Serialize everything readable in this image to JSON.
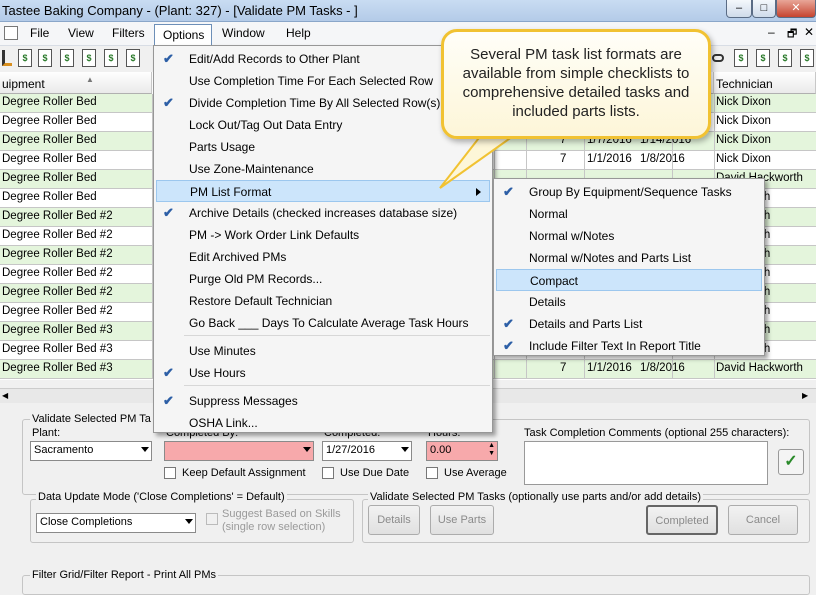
{
  "window": {
    "title": "Tastee Baking Company - (Plant: 327) - [Validate PM Tasks - ]",
    "buttons": [
      "–",
      "□",
      "✕"
    ]
  },
  "menubar": {
    "file": "File",
    "view": "View",
    "filters": "Filters",
    "options": "Options",
    "window": "Window",
    "help": "Help"
  },
  "mdi_buttons": [
    "–",
    "🗗",
    "✕"
  ],
  "grid": {
    "headers": {
      "equipment": "uipment",
      "technician": "Technician"
    },
    "rows": [
      {
        "equipment": "Degree Roller Bed",
        "n": "",
        "start": "",
        "end": "",
        "tech": "Nick Dixon",
        "green": true
      },
      {
        "equipment": "Degree Roller Bed",
        "n": "",
        "start": "",
        "end": "",
        "tech": "Nick Dixon",
        "green": false
      },
      {
        "equipment": "Degree Roller Bed",
        "n": "7",
        "start": "1/7/2016",
        "end": "1/14/2016",
        "tech": "Nick Dixon",
        "green": true
      },
      {
        "equipment": "Degree Roller Bed",
        "n": "7",
        "start": "1/1/2016",
        "end": "1/8/2016",
        "tech": "Nick Dixon",
        "green": false
      },
      {
        "equipment": "Degree Roller Bed",
        "n": "",
        "start": "",
        "end": "",
        "tech": "David Hackworth",
        "green": true
      },
      {
        "equipment": "Degree Roller Bed",
        "n": "",
        "start": "",
        "end": "",
        "tech": "Hackworth",
        "green": false
      },
      {
        "equipment": "Degree Roller Bed #2",
        "n": "",
        "start": "",
        "end": "",
        "tech": "Hackworth",
        "green": true
      },
      {
        "equipment": "Degree Roller Bed #2",
        "n": "",
        "start": "",
        "end": "",
        "tech": "Hackworth",
        "green": false
      },
      {
        "equipment": "Degree Roller Bed #2",
        "n": "",
        "start": "",
        "end": "",
        "tech": "Hackworth",
        "green": true
      },
      {
        "equipment": "Degree Roller Bed #2",
        "n": "",
        "start": "",
        "end": "",
        "tech": "Hackworth",
        "green": false
      },
      {
        "equipment": "Degree Roller Bed #2",
        "n": "",
        "start": "",
        "end": "",
        "tech": "Hackworth",
        "green": true
      },
      {
        "equipment": "Degree Roller Bed #2",
        "n": "",
        "start": "",
        "end": "",
        "tech": "Hackworth",
        "green": false
      },
      {
        "equipment": "Degree Roller Bed #3",
        "n": "",
        "start": "",
        "end": "",
        "tech": "Hackworth",
        "green": true
      },
      {
        "equipment": "Degree Roller Bed #3",
        "n": "",
        "start": "",
        "end": "",
        "tech": "Hackworth",
        "green": false
      },
      {
        "equipment": "Degree Roller Bed #3",
        "n": "7",
        "start": "1/1/2016",
        "end": "1/8/2016",
        "tech": "David Hackworth",
        "green": true
      }
    ]
  },
  "options_menu": {
    "items": [
      {
        "label": "Edit/Add Records to Other Plant",
        "checked": true
      },
      {
        "label": "Use Completion Time For Each Selected Row",
        "checked": false
      },
      {
        "label": "Divide Completion Time By All Selected Row(s)",
        "checked": true
      },
      {
        "label": "Lock Out/Tag Out Data Entry",
        "checked": false
      },
      {
        "label": "Parts Usage",
        "checked": false,
        "submenu": true
      },
      {
        "label": "Use Zone-Maintenance",
        "checked": false
      },
      {
        "label": "PM List Format",
        "checked": false,
        "submenu": true,
        "highlight": true
      },
      {
        "label": "Archive Details (checked increases database size)",
        "checked": true
      },
      {
        "label": "PM -> Work Order Link Defaults",
        "checked": false
      },
      {
        "label": "Edit Archived PMs",
        "checked": false
      },
      {
        "label": "Purge Old PM Records...",
        "checked": false
      },
      {
        "label": "Restore Default Technician",
        "checked": false
      },
      {
        "label": "Go Back ___ Days To Calculate Average Task Hours",
        "checked": false
      },
      {
        "label": "Use Minutes",
        "checked": false
      },
      {
        "label": "Use Hours",
        "checked": true
      },
      {
        "label": "Suppress Messages",
        "checked": true
      },
      {
        "label": "OSHA Link...",
        "checked": false
      }
    ]
  },
  "pm_format_submenu": {
    "items": [
      {
        "label": "Group By Equipment/Sequence Tasks",
        "checked": true
      },
      {
        "label": "Normal",
        "checked": false
      },
      {
        "label": "Normal w/Notes",
        "checked": false
      },
      {
        "label": "Normal w/Notes and Parts List",
        "checked": false
      },
      {
        "label": "Compact",
        "checked": false,
        "highlight": true
      },
      {
        "label": "Details",
        "checked": false
      },
      {
        "label": "Details and Parts List",
        "checked": true
      },
      {
        "label": "Include Filter Text In Report Title",
        "checked": true
      }
    ]
  },
  "callout": "Several PM task list formats are available from simple checklists to comprehensive detailed tasks and included parts lists.",
  "bottom": {
    "validate_group": "Validate Selected PM Ta",
    "plant_label": "Plant:",
    "plant_value": "Sacramento",
    "completed_by_label": "Completed By:",
    "completed_label": "Completed:",
    "completed_value": "1/27/2016",
    "hours_label": "Hours:",
    "hours_value": "0.00",
    "comments_label": "Task Completion Comments (optional 255 characters):",
    "keep_default": "Keep Default Assignment",
    "use_due_date": "Use Due Date",
    "use_average": "Use Average",
    "data_update_group": "Data Update Mode ('Close Completions' = Default)",
    "data_update_value": "Close Completions",
    "suggest_skills": "Suggest Based on Skills",
    "single_row": "(single row selection)",
    "validate_tasks_group": "Validate Selected PM Tasks (optionally use parts and/or add details)",
    "details_btn": "Details",
    "use_parts_btn": "Use Parts",
    "completed_btn": "Completed",
    "cancel_btn": "Cancel",
    "filter_group": "Filter Grid/Filter Report - Print All PMs"
  }
}
